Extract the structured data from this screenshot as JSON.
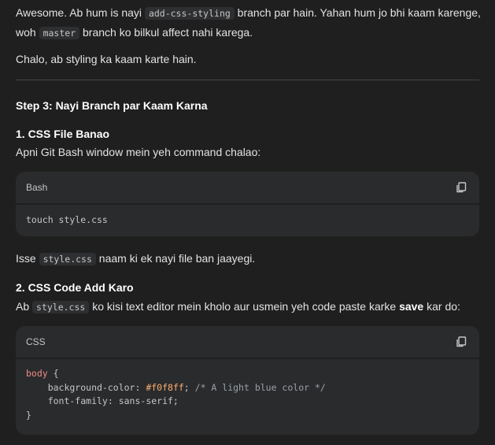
{
  "intro": {
    "t1": "Awesome. Ab hum is nayi ",
    "code1": "add-css-styling",
    "t2": " branch par hain. Yahan hum jo bhi kaam karenge,",
    "t3": "woh ",
    "code2": "master",
    "t4": " branch ko bilkul affect nahi karega."
  },
  "chalo": "Chalo, ab styling ka kaam karte hain.",
  "step_heading": "Step 3: Nayi Branch par Kaam Karna",
  "sub1": {
    "heading": "1. CSS File Banao",
    "text": "Apni Git Bash window mein yeh command chalao:"
  },
  "block1": {
    "lang": "Bash",
    "code": "touch style.css"
  },
  "after1": {
    "t1": "Isse ",
    "code": "style.css",
    "t2": " naam ki ek nayi file ban jaayegi."
  },
  "sub2": {
    "heading": "2. CSS Code Add Karo",
    "t1": "Ab ",
    "code": "style.css",
    "t2": " ko kisi text editor mein kholo aur usmein yeh code paste karke ",
    "bold": "save",
    "t3": " kar do:"
  },
  "block2": {
    "lang": "CSS",
    "line1_sel": "body",
    "line1_brace": " {",
    "line2_prop": "    background-color: ",
    "line2_val": "#f0f8ff",
    "line2_semi": "; ",
    "line2_comment": "/* A light blue color */",
    "line3": "    font-family: sans-serif;",
    "line4": "}"
  },
  "icons": {
    "copy": "copy-icon"
  }
}
